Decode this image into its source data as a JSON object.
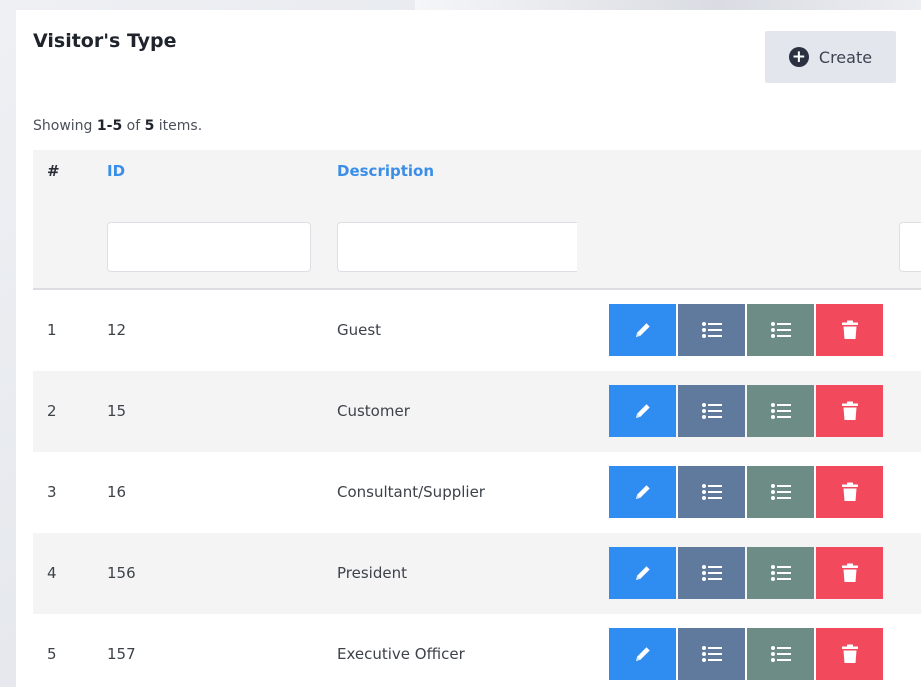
{
  "page": {
    "title": "Visitor's Type",
    "create_label": "Create",
    "summary": {
      "prefix": "Showing",
      "range": "1-5",
      "of": "of",
      "total": "5",
      "suffix": "items."
    }
  },
  "table": {
    "headers": {
      "hash": "#",
      "id": "ID",
      "description": "Description"
    },
    "filters": {
      "id_value": "",
      "description_value": ""
    },
    "rows": [
      {
        "num": "1",
        "id": "12",
        "description": "Guest"
      },
      {
        "num": "2",
        "id": "15",
        "description": "Customer"
      },
      {
        "num": "3",
        "id": "16",
        "description": "Consultant/Supplier"
      },
      {
        "num": "4",
        "id": "156",
        "description": "President"
      },
      {
        "num": "5",
        "id": "157",
        "description": "Executive Officer"
      }
    ]
  },
  "icons": {
    "create": "plus-circle-icon",
    "edit": "pencil-icon",
    "list": "list-icon",
    "delete": "trash-icon"
  },
  "colors": {
    "edit": "#2f8cf0",
    "list_primary": "#607a9e",
    "list_secondary": "#6e8c86",
    "delete": "#f24a5c",
    "link": "#3a8ee8"
  }
}
